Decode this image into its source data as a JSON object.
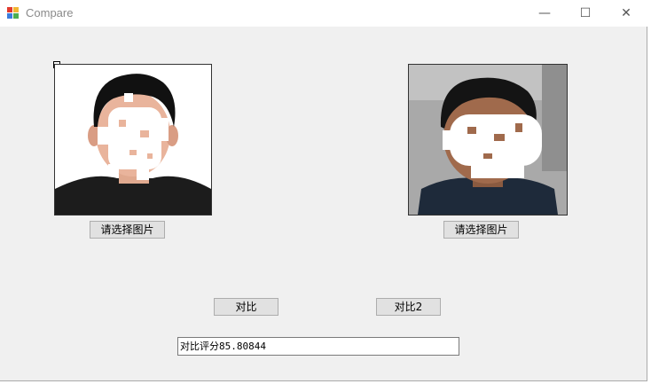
{
  "window": {
    "title": "Compare",
    "controls": {
      "minimize": "—",
      "maximize": "☐",
      "close": "✕"
    }
  },
  "left_panel": {
    "select_button_label": "请选择图片"
  },
  "right_panel": {
    "select_button_label": "请选择图片"
  },
  "actions": {
    "compare_label": "对比",
    "compare2_label": "对比2"
  },
  "result": {
    "text": "对比评分85.80844"
  },
  "colors": {
    "window_bg": "#f0f0f0",
    "button_bg": "#e1e1e1",
    "button_border": "#adadad"
  }
}
